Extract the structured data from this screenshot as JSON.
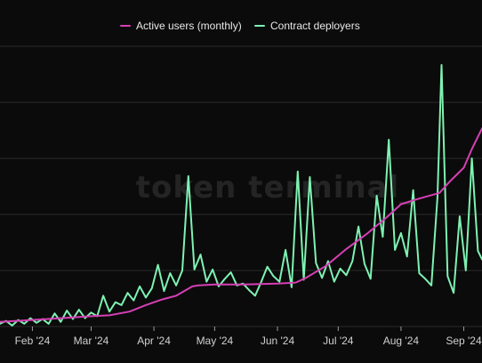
{
  "watermark": "token terminal_",
  "chart_data": {
    "type": "line",
    "title": "",
    "xlabel": "",
    "ylabel": "",
    "x_tick_labels": [
      "Feb '24",
      "Mar '24",
      "Apr '24",
      "May '24",
      "Jun '24",
      "Jul '24",
      "Aug '24",
      "Sep '24"
    ],
    "x_range": [
      "2024-01-16",
      "2024-09-10"
    ],
    "y_axis_labels_visible": false,
    "grid": "horizontal",
    "legend_position": "top-center",
    "series": [
      {
        "name": "Active users (monthly)",
        "color": "#d63fb4",
        "points": [
          [
            "2024-01-16",
            5
          ],
          [
            "2024-02-01",
            7
          ],
          [
            "2024-02-15",
            9
          ],
          [
            "2024-03-01",
            11
          ],
          [
            "2024-03-10",
            12
          ],
          [
            "2024-03-20",
            16
          ],
          [
            "2024-03-28",
            23
          ],
          [
            "2024-04-05",
            29
          ],
          [
            "2024-04-12",
            33
          ],
          [
            "2024-04-20",
            43
          ],
          [
            "2024-04-23",
            44
          ],
          [
            "2024-05-01",
            45
          ],
          [
            "2024-05-15",
            45
          ],
          [
            "2024-06-01",
            46
          ],
          [
            "2024-06-10",
            47
          ],
          [
            "2024-06-15",
            52
          ],
          [
            "2024-06-25",
            65
          ],
          [
            "2024-07-05",
            83
          ],
          [
            "2024-07-15",
            99
          ],
          [
            "2024-07-25",
            117
          ],
          [
            "2024-08-01",
            131
          ],
          [
            "2024-08-10",
            137
          ],
          [
            "2024-08-20",
            143
          ],
          [
            "2024-08-25",
            155
          ],
          [
            "2024-09-01",
            170
          ],
          [
            "2024-09-05",
            190
          ],
          [
            "2024-09-10",
            212
          ]
        ]
      },
      {
        "name": "Contract deployers",
        "color": "#7ef2b2",
        "points": [
          [
            "2024-01-16",
            3
          ],
          [
            "2024-01-19",
            6
          ],
          [
            "2024-01-22",
            1
          ],
          [
            "2024-01-25",
            7
          ],
          [
            "2024-01-28",
            3
          ],
          [
            "2024-01-31",
            9
          ],
          [
            "2024-02-03",
            4
          ],
          [
            "2024-02-06",
            8
          ],
          [
            "2024-02-09",
            3
          ],
          [
            "2024-02-12",
            14
          ],
          [
            "2024-02-15",
            5
          ],
          [
            "2024-02-18",
            17
          ],
          [
            "2024-02-21",
            8
          ],
          [
            "2024-02-24",
            18
          ],
          [
            "2024-02-27",
            9
          ],
          [
            "2024-03-01",
            15
          ],
          [
            "2024-03-04",
            11
          ],
          [
            "2024-03-07",
            33
          ],
          [
            "2024-03-10",
            16
          ],
          [
            "2024-03-13",
            26
          ],
          [
            "2024-03-16",
            23
          ],
          [
            "2024-03-19",
            36
          ],
          [
            "2024-03-22",
            28
          ],
          [
            "2024-03-25",
            43
          ],
          [
            "2024-03-28",
            31
          ],
          [
            "2024-03-31",
            41
          ],
          [
            "2024-04-03",
            66
          ],
          [
            "2024-04-06",
            38
          ],
          [
            "2024-04-09",
            57
          ],
          [
            "2024-04-12",
            44
          ],
          [
            "2024-04-15",
            60
          ],
          [
            "2024-04-18",
            161
          ],
          [
            "2024-04-21",
            61
          ],
          [
            "2024-04-24",
            77
          ],
          [
            "2024-04-27",
            48
          ],
          [
            "2024-04-30",
            61
          ],
          [
            "2024-05-03",
            43
          ],
          [
            "2024-05-06",
            51
          ],
          [
            "2024-05-09",
            58
          ],
          [
            "2024-05-12",
            44
          ],
          [
            "2024-05-15",
            46
          ],
          [
            "2024-05-18",
            39
          ],
          [
            "2024-05-21",
            33
          ],
          [
            "2024-05-24",
            48
          ],
          [
            "2024-05-27",
            64
          ],
          [
            "2024-05-30",
            54
          ],
          [
            "2024-06-02",
            48
          ],
          [
            "2024-06-05",
            82
          ],
          [
            "2024-06-08",
            42
          ],
          [
            "2024-06-11",
            166
          ],
          [
            "2024-06-14",
            50
          ],
          [
            "2024-06-17",
            160
          ],
          [
            "2024-06-20",
            68
          ],
          [
            "2024-06-23",
            52
          ],
          [
            "2024-06-26",
            70
          ],
          [
            "2024-06-29",
            48
          ],
          [
            "2024-07-02",
            62
          ],
          [
            "2024-07-05",
            55
          ],
          [
            "2024-07-08",
            70
          ],
          [
            "2024-07-11",
            107
          ],
          [
            "2024-07-14",
            67
          ],
          [
            "2024-07-17",
            51
          ],
          [
            "2024-07-20",
            140
          ],
          [
            "2024-07-23",
            96
          ],
          [
            "2024-07-26",
            200
          ],
          [
            "2024-07-29",
            82
          ],
          [
            "2024-08-01",
            100
          ],
          [
            "2024-08-04",
            75
          ],
          [
            "2024-08-07",
            146
          ],
          [
            "2024-08-10",
            57
          ],
          [
            "2024-08-13",
            51
          ],
          [
            "2024-08-16",
            44
          ],
          [
            "2024-08-19",
            138
          ],
          [
            "2024-08-21",
            280
          ],
          [
            "2024-08-24",
            54
          ],
          [
            "2024-08-27",
            36
          ],
          [
            "2024-08-30",
            118
          ],
          [
            "2024-09-02",
            60
          ],
          [
            "2024-09-05",
            180
          ],
          [
            "2024-09-08",
            81
          ],
          [
            "2024-09-10",
            72
          ]
        ]
      }
    ]
  }
}
